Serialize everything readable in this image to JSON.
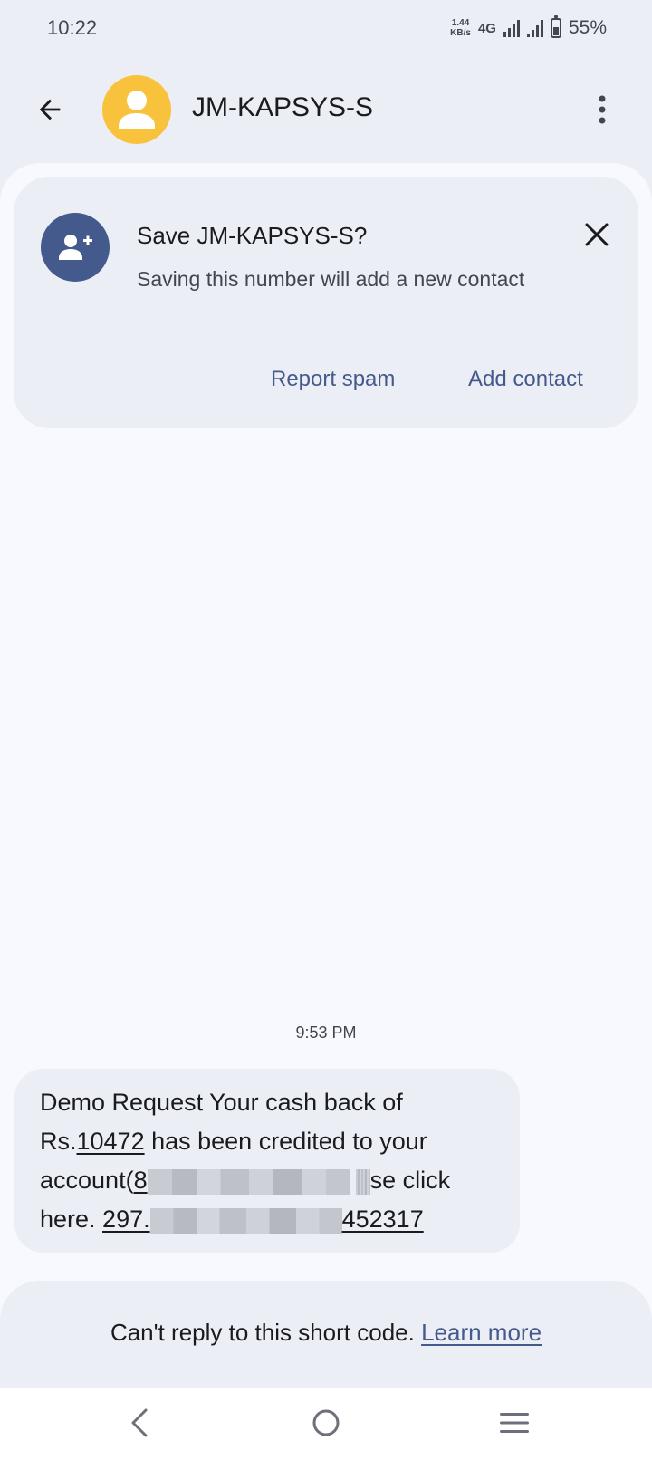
{
  "status_bar": {
    "time": "10:22",
    "speed_value": "1.44",
    "speed_unit": "KB/s",
    "network": "4G",
    "battery": "55%",
    "battery_level": 0.55
  },
  "app_bar": {
    "contact_name": "JM-KAPSYS-S",
    "icons": {
      "back": "arrow-back-icon",
      "avatar": "person-icon",
      "more": "more-vert-icon"
    },
    "avatar_color": "#f9c23c"
  },
  "save_card": {
    "title": "Save JM-KAPSYS-S?",
    "text": "Saving this number will add a new contact",
    "report_spam_label": "Report spam",
    "add_contact_label": "Add contact",
    "icon": "add-person-icon",
    "accent_color": "#455a8c"
  },
  "conversation": {
    "timestamp": "9:53 PM",
    "message": {
      "line1": "Demo Request Your cash back of",
      "line2_prefix": "Rs.",
      "amount": "10472",
      "line2_suffix": " has been credited to your",
      "line3_prefix": "account(",
      "account_start": "8",
      "line3_suffix": "se click",
      "line4_prefix": "here. ",
      "link_start": "297.",
      "link_end": "452317"
    }
  },
  "footer": {
    "cant_reply_text": "Can't reply to this short code.",
    "learn_more_label": "Learn more"
  },
  "nav_bar": {
    "icons": {
      "back": "nav-back-icon",
      "home": "nav-home-icon",
      "recents": "nav-recents-icon"
    }
  }
}
